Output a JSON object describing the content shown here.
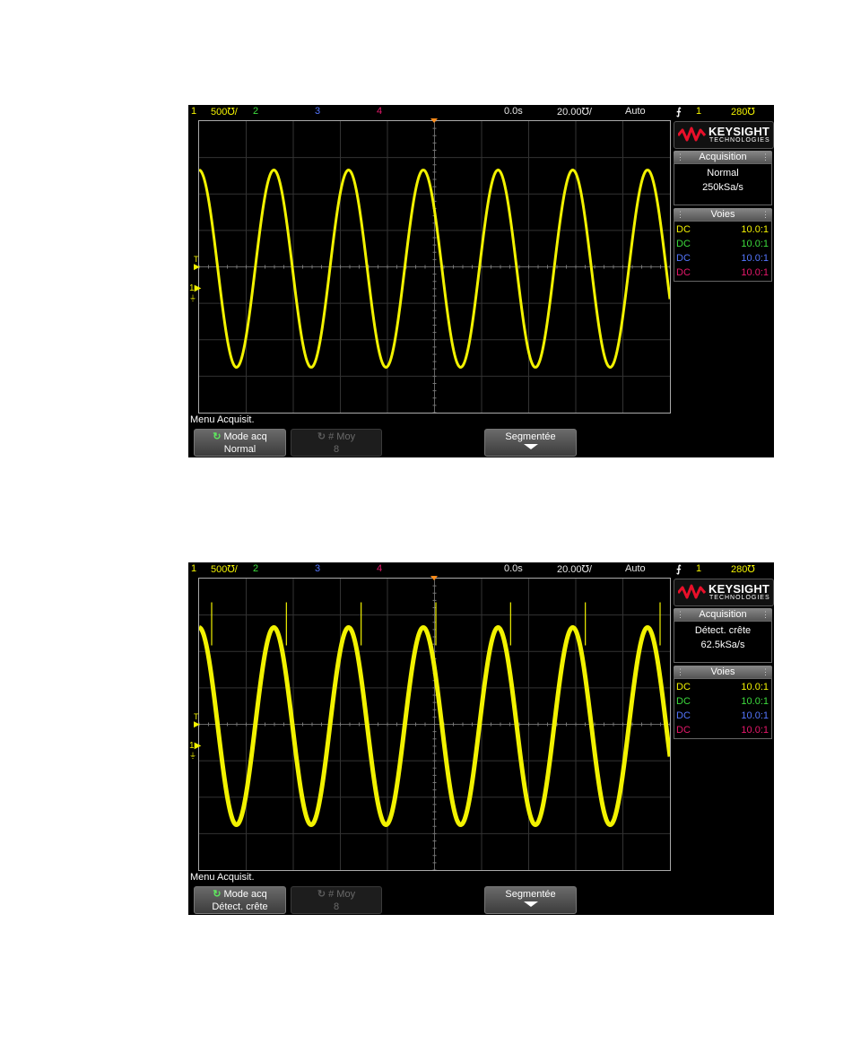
{
  "screens": [
    {
      "status": {
        "ch1": "1",
        "ch1_scale": "500℧/",
        "ch2": "2",
        "ch3": "3",
        "ch4": "4",
        "delay": "0.0s",
        "timebase": "20.00℧/",
        "trig_mode": "Auto",
        "trig_symbol": "⨍",
        "trig_source": "1",
        "trig_level": "280℧"
      },
      "logo": {
        "brand": "KEYSIGHT",
        "sub": "TECHNOLOGIES"
      },
      "acquisition": {
        "header": "Acquisition",
        "mode": "Normal",
        "rate": "250kSa/s"
      },
      "voies": {
        "header": "Voies",
        "rows": [
          {
            "coupling": "DC",
            "probe": "10.0:1",
            "color": "#f2f200"
          },
          {
            "coupling": "DC",
            "probe": "10.0:1",
            "color": "#3ddc3d"
          },
          {
            "coupling": "DC",
            "probe": "10.0:1",
            "color": "#5577ff"
          },
          {
            "coupling": "DC",
            "probe": "10.0:1",
            "color": "#e8186c"
          }
        ]
      },
      "trigger_marker": "T",
      "channel_marker": "1",
      "menu": {
        "title": "Menu Acquisit.",
        "mode_label": "Mode acq",
        "mode_value": "Normal",
        "avg_label": "# Moy",
        "avg_value": "8",
        "segment_label": "Segmentée"
      },
      "waveform": {
        "color": "#f2f200",
        "cycles": 6.3,
        "peak_detect": false
      }
    },
    {
      "status": {
        "ch1": "1",
        "ch1_scale": "500℧/",
        "ch2": "2",
        "ch3": "3",
        "ch4": "4",
        "delay": "0.0s",
        "timebase": "20.00℧/",
        "trig_mode": "Auto",
        "trig_symbol": "⨍",
        "trig_source": "1",
        "trig_level": "280℧"
      },
      "logo": {
        "brand": "KEYSIGHT",
        "sub": "TECHNOLOGIES"
      },
      "acquisition": {
        "header": "Acquisition",
        "mode": "Détect. crête",
        "rate": "62.5kSa/s"
      },
      "voies": {
        "header": "Voies",
        "rows": [
          {
            "coupling": "DC",
            "probe": "10.0:1",
            "color": "#f2f200"
          },
          {
            "coupling": "DC",
            "probe": "10.0:1",
            "color": "#3ddc3d"
          },
          {
            "coupling": "DC",
            "probe": "10.0:1",
            "color": "#5577ff"
          },
          {
            "coupling": "DC",
            "probe": "10.0:1",
            "color": "#e8186c"
          }
        ]
      },
      "trigger_marker": "T",
      "channel_marker": "1",
      "menu": {
        "title": "Menu Acquisit.",
        "mode_label": "Mode acq",
        "mode_value": "Détect. crête",
        "avg_label": "# Moy",
        "avg_value": "8",
        "segment_label": "Segmentée"
      },
      "waveform": {
        "color": "#f2f200",
        "cycles": 6.3,
        "peak_detect": true
      }
    }
  ]
}
